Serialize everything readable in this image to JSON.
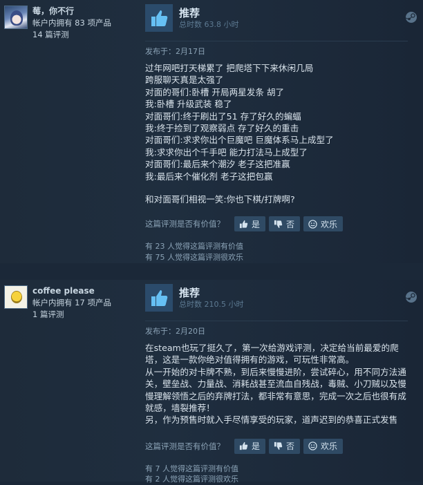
{
  "reviews": [
    {
      "author_name": "莓，你不行",
      "products_owned": "帐户内拥有 83 项产品",
      "reviews_count": "14 篇评测",
      "recommendation": "推荐",
      "hours": "总时数 63.8 小时",
      "posted": "发布于：2月17日",
      "paragraphs": [
        "过年网吧打天梯累了 把爬塔下下来休闲几局",
        "跨服聊天真是太强了",
        "对面的哥们:卧槽 开局两星发条 胡了",
        "我:卧槽 升级武装 稳了",
        "对面哥们:终于刷出了51 存了好久的蝙蝠",
        "我:终于捡到了观察弱点 存了好久的重击",
        "对面哥们:求求你出个巨魔吧 巨魔体系马上成型了",
        "我:求求你出个千手吧 能力打法马上成型了",
        "对面哥们:最后来个潮汐 老子这把准赢",
        "我:最后来个催化剂 老子这把包赢",
        "",
        "和对面哥们相视一笑:你也下棋/打牌啊?"
      ],
      "helpful_question": "这篇评测是否有价值？",
      "btn_yes": "是",
      "btn_no": "否",
      "btn_funny": "欢乐",
      "helpful_stat": "有 23 人觉得这篇评测有价值",
      "funny_stat": "有 75 人觉得这篇评测很欢乐"
    },
    {
      "author_name": "coffee please",
      "products_owned": "帐户内拥有 17 项产品",
      "reviews_count": "1 篇评测",
      "recommendation": "推荐",
      "hours": "总时数 210.5 小时",
      "posted": "发布于：2月20日",
      "paragraphs": [
        "在steam也玩了挺久了，第一次给游戏评测，决定给当前最爱的爬塔，这是一款你绝对值得拥有的游戏，可玩性非常高。",
        "从一开始的对卡牌不熟，到后来慢慢进阶，尝试碎心，用不同方法通关，壁垒战、力量战、消耗战甚至流血自残战，毒贼、小刀贼以及慢慢理解领悟之后的弃牌打法，都非常有意思，完成一次之后也很有成就感，墙裂推荐！",
        "另，作为预售时就入手尽情享受的玩家，道声迟到的恭喜正式发售"
      ],
      "helpful_question": "这篇评测是否有价值？",
      "btn_yes": "是",
      "btn_no": "否",
      "btn_funny": "欢乐",
      "helpful_stat": "有 7 人觉得这篇评测有价值",
      "funny_stat": "有 2 人觉得这篇评测很欢乐"
    }
  ],
  "icons": {
    "recommend": "thumbs-up-icon",
    "vote_yes": "thumbs-up-icon",
    "vote_no": "thumbs-down-icon",
    "vote_funny": "smiley-icon",
    "platform": "steam-icon"
  },
  "colors": {
    "background": "#1b2838",
    "thumb_box": "#2b4b6b",
    "thumb": "#66c0f4",
    "button": "#2f4a64"
  }
}
